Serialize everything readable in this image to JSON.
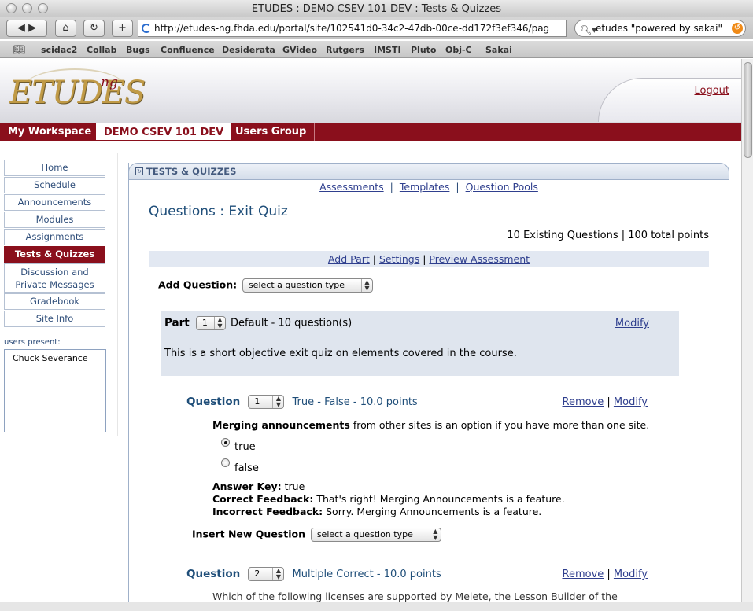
{
  "browser": {
    "window_title": "ETUDES : DEMO CSEV 101 DEV : Tests & Quizzes",
    "url": "http://etudes-ng.fhda.edu/portal/site/102541d0-34c2-47db-00ce-dd172f3ef346/pag",
    "search": "etudes \"powered by sakai\"",
    "bookmarks": [
      "scidac2",
      "Collab",
      "Bugs",
      "Confluence",
      "Desiderata",
      "GVideo",
      "Rutgers",
      "IMSTI",
      "Pluto",
      "Obj-C",
      "Sakai"
    ]
  },
  "header": {
    "logo": "ETUDES",
    "logo_sup": "ng",
    "logout": "Logout"
  },
  "sites": [
    "My Workspace",
    "DEMO CSEV 101 DEV",
    "Users Group"
  ],
  "tools": [
    "Home",
    "Schedule",
    "Announcements",
    "Modules",
    "Assignments",
    "Tests & Quizzes",
    "Discussion and Private Messages",
    "Gradebook",
    "Site Info"
  ],
  "presence": {
    "label": "users present:",
    "users": [
      "Chuck Severance"
    ]
  },
  "tool": {
    "title": "TESTS & QUIZZES",
    "nav": [
      "Assessments",
      "Templates",
      "Question Pools"
    ],
    "page_title": "Questions : Exit Quiz",
    "summary": "10 Existing Questions | 100 total points",
    "actions": [
      "Add Part",
      "Settings",
      "Preview Assessment"
    ],
    "add_question_label": "Add Question:",
    "select_placeholder": "select a question type",
    "part": {
      "label": "Part",
      "number": "1",
      "title": "Default - 10 question(s)",
      "modify": "Modify",
      "description": "This is a short objective exit quiz on elements covered in the course."
    },
    "questions": [
      {
        "label": "Question",
        "number": "1",
        "info": "True - False - 10.0 points",
        "remove": "Remove",
        "modify": "Modify",
        "text_bold": "Merging announcements",
        "text_rest": " from other sites is an option if you have more than one site.",
        "options": [
          "true",
          "false"
        ],
        "answer_key_label": "Answer Key:",
        "answer_key": " true",
        "correct_label": "Correct Feedback:",
        "correct": " That's right! Merging Announcements is a feature.",
        "incorrect_label": "Incorrect Feedback:",
        "incorrect": " Sorry. Merging Announcements is a feature."
      },
      {
        "label": "Question",
        "number": "2",
        "info": "Multiple Correct - 10.0 points",
        "remove": "Remove",
        "modify": "Modify",
        "partial_text": "Which of the following licenses are supported by Melete, the Lesson Builder of the"
      }
    ],
    "insert_label": "Insert New Question"
  }
}
